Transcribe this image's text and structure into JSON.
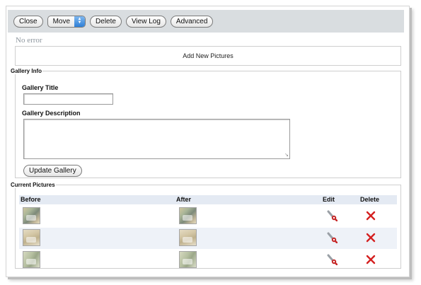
{
  "toolbar": {
    "close_label": "Close",
    "move_label": "Move",
    "delete_label": "Delete",
    "view_log_label": "View Log",
    "advanced_label": "Advanced"
  },
  "status": "No error",
  "add_pictures_label": "Add New Pictures",
  "gallery_info": {
    "legend": "Gallery Info",
    "title_label": "Gallery Title",
    "title_value": "",
    "description_label": "Gallery Description",
    "description_value": "",
    "update_label": "Update Gallery"
  },
  "current_pictures": {
    "legend": "Current Pictures",
    "columns": [
      "Before",
      "After",
      "Edit",
      "Delete"
    ],
    "rows": [
      {
        "before_icon": "bathroom-thumbnail",
        "after_icon": "bathroom-thumbnail",
        "edit_icon": "wrench-icon",
        "delete_icon": "red-x-icon"
      },
      {
        "before_icon": "bathroom-thumbnail",
        "after_icon": "bathroom-thumbnail",
        "edit_icon": "wrench-icon",
        "delete_icon": "red-x-icon"
      },
      {
        "before_icon": "bathroom-thumbnail",
        "after_icon": "bathroom-thumbnail",
        "edit_icon": "wrench-icon",
        "delete_icon": "red-x-icon"
      }
    ]
  },
  "colors": {
    "toolbar_bg": "#d9dde0",
    "status_text": "#8d969e",
    "table_header_bg": "#e4eaf3",
    "alt_row_bg": "#eef2f8",
    "delete_red": "#d42020",
    "edit_red": "#c62828"
  }
}
